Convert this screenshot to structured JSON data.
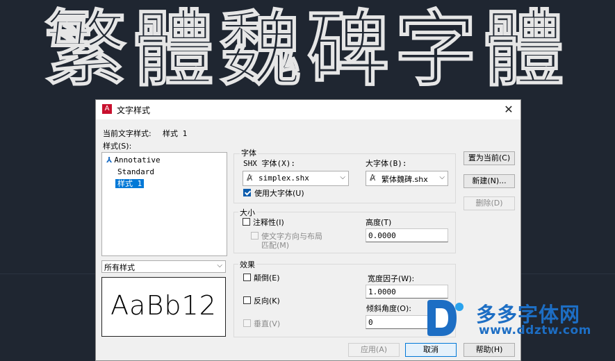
{
  "banner": {
    "text": "繁體魏碑字體"
  },
  "dialog": {
    "title": "文字样式",
    "app_icon_letter": "A",
    "current_style_label": "当前文字样式:",
    "current_style_value": "样式 1",
    "styles_label": "样式(S):",
    "styles": [
      {
        "label": "Annotative",
        "annotative": true,
        "selected": false
      },
      {
        "label": "Standard",
        "annotative": false,
        "selected": false
      },
      {
        "label": "样式 1",
        "annotative": false,
        "selected": true
      }
    ],
    "filter_value": "所有样式",
    "preview_text": "AaBb12",
    "font_group": {
      "title": "字体",
      "shx_font_label": "SHX 字体(X):",
      "shx_font_value": "simplex.shx",
      "big_font_label": "大字体(B):",
      "big_font_value": "繁体魏碑.shx",
      "use_big_font_label": "使用大字体(U)",
      "use_big_font_checked": true
    },
    "size_group": {
      "title": "大小",
      "annotative_label": "注释性(I)",
      "annotative_checked": false,
      "match_orientation_label_1": "使文字方向与布局",
      "match_orientation_label_2": "匹配(M)",
      "height_label": "高度(T)",
      "height_value": "0.0000"
    },
    "effects_group": {
      "title": "效果",
      "upside_down_label": "颠倒(E)",
      "backwards_label": "反向(K)",
      "vertical_label": "垂直(V)",
      "width_factor_label": "宽度因子(W):",
      "width_factor_value": "1.0000",
      "oblique_label": "倾斜角度(O):",
      "oblique_value": "0"
    },
    "buttons": {
      "set_current": "置为当前(C)",
      "new": "新建(N)...",
      "delete": "删除(D)",
      "apply": "应用(A)",
      "cancel": "取消",
      "help": "帮助(H)"
    }
  },
  "watermark": {
    "name": "多多字体网",
    "url": "www.ddztw.com",
    "color": "#1d6ec4"
  }
}
